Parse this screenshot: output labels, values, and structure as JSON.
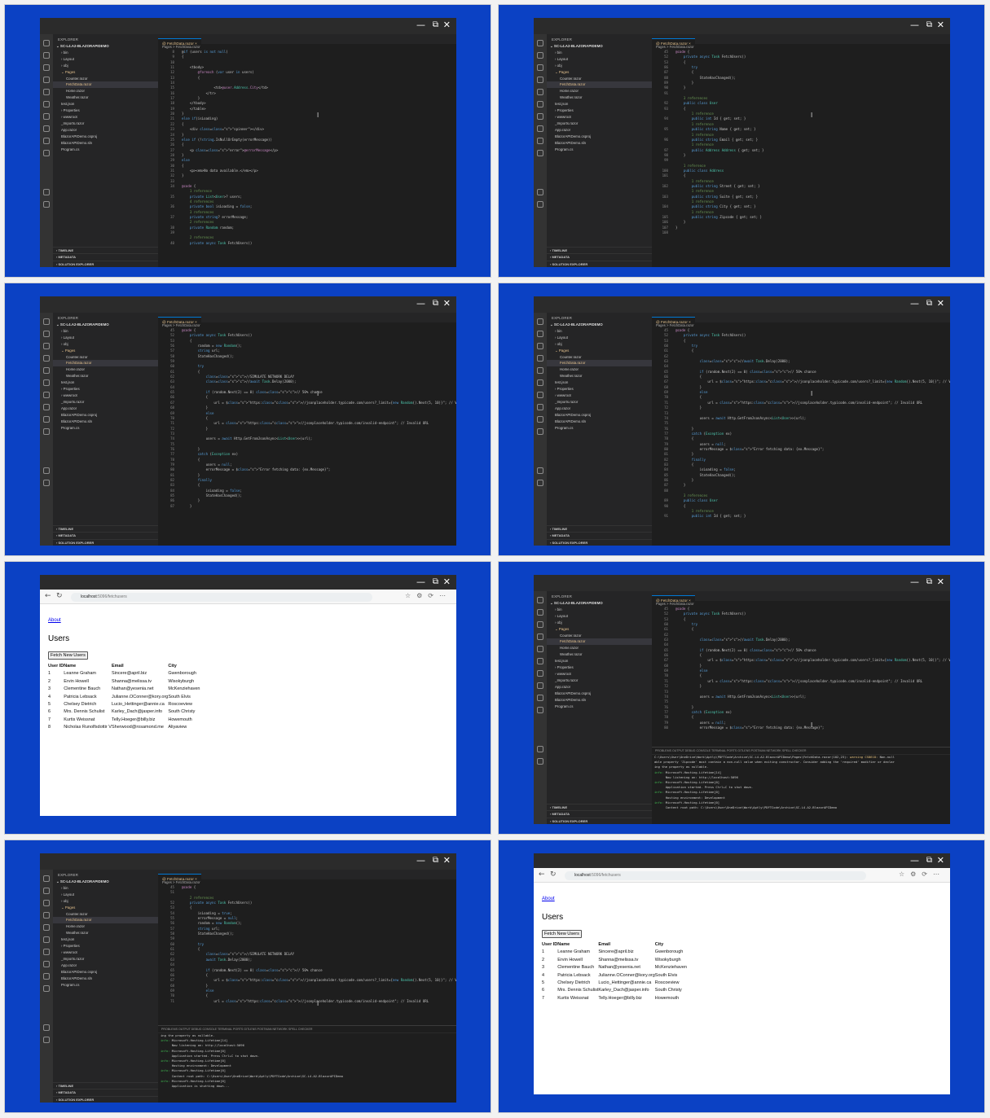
{
  "window_controls": {
    "minimize": "—",
    "maximize": "⧉",
    "close": "✕"
  },
  "explorer": {
    "header": "EXPLORER",
    "project": "SC-L4.A2-BLAZORAPIDEMO",
    "items": [
      "bin",
      "Layout",
      "obj",
      "Pages",
      "Counter.razor",
      "FetchData.razor",
      "Home.razor",
      "Weather.razor",
      "test.json",
      "Properties",
      "wwwroot",
      "_Imports.razor",
      "App.razor",
      "BlazorAPIDemo.csproj",
      "BlazorAPIDemo.sln",
      "Program.cs"
    ],
    "bottom": [
      "TIMELINE",
      "METADATA",
      "SOLUTION EXPLORER"
    ]
  },
  "editor": {
    "tab": "FetchData.razor",
    "breadcrumb": "Pages > FetchData.razor"
  },
  "panels": {
    "p1": {
      "lines": [
        [
          "8",
          "@if (users is not null)"
        ],
        [
          "9",
          "{"
        ],
        [
          "10",
          ""
        ],
        [
          "11",
          "    <tbody>"
        ],
        [
          "12",
          "        @foreach (var user in users)"
        ],
        [
          "13",
          "        {"
        ],
        [
          "14",
          ""
        ],
        [
          "15",
          "                <td>@user.Address.City</td>"
        ],
        [
          "16",
          "            </tr>"
        ],
        [
          "17",
          "        }"
        ],
        [
          "18",
          "    </tbody>"
        ],
        [
          "19",
          "    </table>"
        ],
        [
          "20",
          "}"
        ],
        [
          "21",
          "else if(isLoading)"
        ],
        [
          "22",
          "{"
        ],
        [
          "23",
          "    <div class=\"spinner\"></div>"
        ],
        [
          "24",
          "}"
        ],
        [
          "25",
          "else if (!string.IsNullOrEmpty(errorMessage))"
        ],
        [
          "26",
          "{"
        ],
        [
          "27",
          "    <p class=\"error\">@errorMessage</p>"
        ],
        [
          "28",
          "}"
        ],
        [
          "29",
          "else"
        ],
        [
          "30",
          "{"
        ],
        [
          "31",
          "    <p><em>No data available.</em></p>"
        ],
        [
          "32",
          "}"
        ],
        [
          "33",
          ""
        ],
        [
          "34",
          "@code {"
        ],
        [
          "",
          "    1 reference"
        ],
        [
          "35",
          "    private List<User>? users;"
        ],
        [
          "",
          "    4 references"
        ],
        [
          "36",
          "    private bool isLoading = false;"
        ],
        [
          "",
          "    3 references"
        ],
        [
          "37",
          "    private string? errorMessage;"
        ],
        [
          "",
          "    2 references"
        ],
        [
          "38",
          "    private Random random;"
        ],
        [
          "39",
          ""
        ],
        [
          "",
          "    2 references"
        ],
        [
          "40",
          "    private async Task FetchUsers()"
        ]
      ]
    },
    "p2": {
      "lines": [
        [
          "45",
          "@code {"
        ],
        [
          "52",
          "    private async Task FetchUsers()"
        ],
        [
          "53",
          "    {"
        ],
        [
          "86",
          "        try"
        ],
        [
          "87",
          "        {"
        ],
        [
          "88",
          "            StateHasChanged();"
        ],
        [
          "89",
          "        }"
        ],
        [
          "90",
          "    }"
        ],
        [
          "91",
          ""
        ],
        [
          "",
          "    3 references"
        ],
        [
          "92",
          "    public class User"
        ],
        [
          "93",
          "    {"
        ],
        [
          "",
          "        1 reference"
        ],
        [
          "94",
          "        public int Id { get; set; }"
        ],
        [
          "",
          "        1 reference"
        ],
        [
          "95",
          "        public string Name { get; set; }"
        ],
        [
          "",
          "        1 reference"
        ],
        [
          "96",
          "        public string Email { get; set; }"
        ],
        [
          "",
          "        1 reference"
        ],
        [
          "97",
          "        public Address Address { get; set; }"
        ],
        [
          "98",
          "    }"
        ],
        [
          "99",
          ""
        ],
        [
          "",
          "    1 reference"
        ],
        [
          "100",
          "    public class Address"
        ],
        [
          "101",
          "    {"
        ],
        [
          "",
          "        1 reference"
        ],
        [
          "102",
          "        public string Street { get; set; }"
        ],
        [
          "",
          "        1 reference"
        ],
        [
          "103",
          "        public string Suite { get; set; }"
        ],
        [
          "",
          "        1 reference"
        ],
        [
          "104",
          "        public string City { get; set; }"
        ],
        [
          "",
          "        1 reference"
        ],
        [
          "105",
          "        public string Zipcode { get; set; }"
        ],
        [
          "106",
          "    }"
        ],
        [
          "107",
          "}"
        ],
        [
          "108",
          ""
        ]
      ]
    },
    "p3": {
      "lines": [
        [
          "45",
          "@code {"
        ],
        [
          "52",
          "    private async Task FetchUsers()"
        ],
        [
          "53",
          "    {"
        ],
        [
          "56",
          "        random = new Random();"
        ],
        [
          "57",
          "        string url;"
        ],
        [
          "58",
          "        StateHasChanged();"
        ],
        [
          "59",
          ""
        ],
        [
          "60",
          "        try"
        ],
        [
          "61",
          "        {"
        ],
        [
          "62",
          "            //SIMULATE NETWORK DELAY"
        ],
        [
          "63",
          "            //await Task.Delay(2000);"
        ],
        [
          "64",
          ""
        ],
        [
          "65",
          "            if (random.Next(2) == 0) // 50% chance"
        ],
        [
          "66",
          "            {"
        ],
        [
          "67",
          "                url = $\"https://jsonplaceholder.typicode.com/users?_limit={new Random().Next(5, 10)}\"; // Valid URL"
        ],
        [
          "68",
          "            }"
        ],
        [
          "69",
          "            else"
        ],
        [
          "70",
          "            {"
        ],
        [
          "71",
          "                url = \"https://jsonplaceholder.typicode.com/invalid-endpoint\"; // Invalid URL"
        ],
        [
          "72",
          "            }"
        ],
        [
          "73",
          ""
        ],
        [
          "74",
          "            users = await Http.GetFromJsonAsync<List<User>>(url);"
        ],
        [
          "75",
          ""
        ],
        [
          "76",
          "        }"
        ],
        [
          "77",
          "        catch (Exception ex)"
        ],
        [
          "78",
          "        {"
        ],
        [
          "79",
          "            users = null;"
        ],
        [
          "80",
          "            errorMessage = $\"Error fetching data: {ex.Message}\";"
        ],
        [
          "81",
          "        }"
        ],
        [
          "82",
          "        finally"
        ],
        [
          "83",
          "        {"
        ],
        [
          "84",
          "            isLoading = false;"
        ],
        [
          "85",
          "            StateHasChanged();"
        ],
        [
          "86",
          "        }"
        ],
        [
          "87",
          "    }"
        ]
      ]
    },
    "p4": {
      "lines": [
        [
          "45",
          "@code {"
        ],
        [
          "52",
          "    private async Task FetchUsers()"
        ],
        [
          "53",
          "    {"
        ],
        [
          "60",
          "        try"
        ],
        [
          "61",
          "        {"
        ],
        [
          "62",
          ""
        ],
        [
          "63",
          "            //await Task.Delay(2000);"
        ],
        [
          "64",
          ""
        ],
        [
          "65",
          "            if (random.Next(2) == 0) // 50% chance"
        ],
        [
          "66",
          "            {"
        ],
        [
          "67",
          "                url = $\"https://jsonplaceholder.typicode.com/users?_limit={new Random().Next(5, 10)}\"; // Valid URL"
        ],
        [
          "68",
          "            }"
        ],
        [
          "69",
          "            else"
        ],
        [
          "70",
          "            {"
        ],
        [
          "71",
          "                url = \"https://jsonplaceholder.typicode.com/invalid-endpoint\"; // Invalid URL"
        ],
        [
          "72",
          "            }"
        ],
        [
          "73",
          ""
        ],
        [
          "74",
          "            users = await Http.GetFromJsonAsync<List<User>>(url);"
        ],
        [
          "75",
          ""
        ],
        [
          "76",
          "        }"
        ],
        [
          "77",
          "        catch (Exception ex)"
        ],
        [
          "78",
          "        {"
        ],
        [
          "79",
          "            users = null;"
        ],
        [
          "80",
          "            errorMessage = $\"Error fetching data: {ex.Message}\";"
        ],
        [
          "81",
          "        }"
        ],
        [
          "82",
          "        finally"
        ],
        [
          "83",
          "        {"
        ],
        [
          "84",
          "            isLoading = false;"
        ],
        [
          "85",
          "            StateHasChanged();"
        ],
        [
          "86",
          "        }"
        ],
        [
          "87",
          "    }"
        ],
        [
          "88",
          ""
        ],
        [
          "",
          "    3 references"
        ],
        [
          "89",
          "    public class User"
        ],
        [
          "90",
          "    {"
        ],
        [
          "",
          "        1 reference"
        ],
        [
          "91",
          "        public int Id { get; set; }"
        ]
      ]
    },
    "p6": {
      "lines": [
        [
          "45",
          "@code {"
        ],
        [
          "52",
          "    private async Task FetchUsers()"
        ],
        [
          "53",
          "    {"
        ],
        [
          "60",
          "        try"
        ],
        [
          "61",
          "        {"
        ],
        [
          "62",
          ""
        ],
        [
          "63",
          "            //await Task.Delay(2000);"
        ],
        [
          "64",
          ""
        ],
        [
          "65",
          "            if (random.Next(2) == 0) // 50% chance"
        ],
        [
          "66",
          "            {"
        ],
        [
          "67",
          "                url = $\"https://jsonplaceholder.typicode.com/users?_limit={new Random().Next(5, 10)}\"; // Valid URL"
        ],
        [
          "68",
          "            }"
        ],
        [
          "69",
          "            else"
        ],
        [
          "70",
          "            {"
        ],
        [
          "71",
          "                url = \"https://jsonplaceholder.typicode.com/invalid-endpoint\"; // Invalid URL"
        ],
        [
          "72",
          "            }"
        ],
        [
          "73",
          ""
        ],
        [
          "74",
          "            users = await Http.GetFromJsonAsync<List<User>>(url);"
        ],
        [
          "75",
          ""
        ],
        [
          "76",
          "        }"
        ],
        [
          "77",
          "        catch (Exception ex)"
        ],
        [
          "78",
          "        {"
        ],
        [
          "79",
          "            users = null;"
        ],
        [
          "80",
          "            errorMessage = $\"Error fetching data: {ex.Message}\";"
        ]
      ],
      "terminal_tabs": "PROBLEMS  OUTPUT  DEBUG CONSOLE  TERMINAL  PORTS  GITLENS  POSTMAN NETWORK  SPELL CHECKER",
      "terminal": [
        "C:\\Users\\User\\OneDrive\\Work\\Aptly\\PDFTCode\\Archive\\SC-L4.A2-BlazorAPIDemo\\Pages\\FetchData.razor(102,23): warning CS8618: Non-null",
        "able property 'Zipcode' must contain a non-null value when exiting constructor. Consider adding the 'required' modifier or declar",
        "ing the property as nullable.",
        "info: Microsoft.Hosting.Lifetime[14]",
        "      Now listening on: http://localhost:5096",
        "info: Microsoft.Hosting.Lifetime[0]",
        "      Application started. Press Ctrl+C to shut down.",
        "info: Microsoft.Hosting.Lifetime[0]",
        "      Hosting environment: Development",
        "info: Microsoft.Hosting.Lifetime[0]",
        "      Content root path: C:\\Users\\User\\OneDrive\\Work\\Aptly\\PDFTCode\\Archive\\SC-L4.A2-BlazorAPIDemo"
      ]
    },
    "p7": {
      "lines": [
        [
          "45",
          "@code {"
        ],
        [
          "51",
          ""
        ],
        [
          "",
          "    2 references"
        ],
        [
          "52",
          "    private async Task FetchUsers()"
        ],
        [
          "53",
          "    {"
        ],
        [
          "54",
          "        isLoading = true;"
        ],
        [
          "55",
          "        errorMessage = null;"
        ],
        [
          "56",
          "        random = new Random();"
        ],
        [
          "57",
          "        string url;"
        ],
        [
          "58",
          "        StateHasChanged();"
        ],
        [
          "59",
          ""
        ],
        [
          "60",
          "        try"
        ],
        [
          "61",
          "        {"
        ],
        [
          "62",
          "            //SIMULATE NETWORK DELAY"
        ],
        [
          "63",
          "            await Task.Delay(2000);"
        ],
        [
          "64",
          ""
        ],
        [
          "65",
          "            if (random.Next(2) == 0) // 50% chance"
        ],
        [
          "66",
          "            {"
        ],
        [
          "67",
          "                url = $\"https://jsonplaceholder.typicode.com/users?_limit={new Random().Next(5, 10)}\"; // Valid URL"
        ],
        [
          "68",
          "            }"
        ],
        [
          "69",
          "            else"
        ],
        [
          "70",
          "            {"
        ],
        [
          "71",
          "                url = \"https://jsonplaceholder.typicode.com/invalid-endpoint\"; // Invalid URL"
        ]
      ],
      "terminal_tabs": "PROBLEMS  OUTPUT  DEBUG CONSOLE  TERMINAL  PORTS  GITLENS  POSTMAN NETWORK  SPELL CHECKER",
      "terminal": [
        "ing the property as nullable.",
        "info: Microsoft.Hosting.Lifetime[14]",
        "      Now listening on: http://localhost:5096",
        "info: Microsoft.Hosting.Lifetime[0]",
        "      Application started. Press Ctrl+C to shut down.",
        "info: Microsoft.Hosting.Lifetime[0]",
        "      Hosting environment: Development",
        "info: Microsoft.Hosting.Lifetime[0]",
        "      Content root path: C:\\Users\\User\\OneDrive\\Work\\Aptly\\PDFTCode\\Archive\\SC-L4.A2-BlazorAPIDemo",
        "info: Microsoft.Hosting.Lifetime[0]",
        "      Application is shutting down..."
      ]
    }
  },
  "browser": {
    "url_host": "localhost",
    "url_path": ":5096/fetchusers",
    "about_link": "About",
    "heading": "Users",
    "fetch_button": "Fetch New Users",
    "columns": [
      "User ID",
      "Name",
      "Email",
      "City"
    ],
    "rows_a": [
      [
        "1",
        "Leanne Graham",
        "Sincere@april.biz",
        "Gwenborough"
      ],
      [
        "2",
        "Ervin Howell",
        "Shanna@melissa.tv",
        "Wisokyburgh"
      ],
      [
        "3",
        "Clementine Bauch",
        "Nathan@yesenia.net",
        "McKenziehaven"
      ],
      [
        "4",
        "Patricia Lebsack",
        "Julianne.OConner@kory.org",
        "South Elvis"
      ],
      [
        "5",
        "Chelsey Dietrich",
        "Lucio_Hettinger@annie.ca",
        "Roscoeview"
      ],
      [
        "6",
        "Mrs. Dennis Schulist",
        "Karley_Dach@jasper.info",
        "South Christy"
      ],
      [
        "7",
        "Kurtis Weissnat",
        "Telly.Hoeger@billy.biz",
        "Howemouth"
      ],
      [
        "8",
        "Nicholas Runolfsdottir V",
        "Sherwood@rosamond.me",
        "Aliyaview"
      ]
    ],
    "rows_b": [
      [
        "1",
        "Leanne Graham",
        "Sincere@april.biz",
        "Gwenborough"
      ],
      [
        "2",
        "Ervin Howell",
        "Shanna@melissa.tv",
        "Wisokyburgh"
      ],
      [
        "3",
        "Clementine Bauch",
        "Nathan@yesenia.net",
        "McKenziehaven"
      ],
      [
        "4",
        "Patricia Lebsack",
        "Julianne.OConner@kory.org",
        "South Elvis"
      ],
      [
        "5",
        "Chelsey Dietrich",
        "Lucio_Hettinger@annie.ca",
        "Roscoeview"
      ],
      [
        "6",
        "Mrs. Dennis Schulist",
        "Karley_Dach@jasper.info",
        "South Christy"
      ],
      [
        "7",
        "Kurtis Weissnat",
        "Telly.Hoeger@billy.biz",
        "Howemouth"
      ]
    ]
  }
}
